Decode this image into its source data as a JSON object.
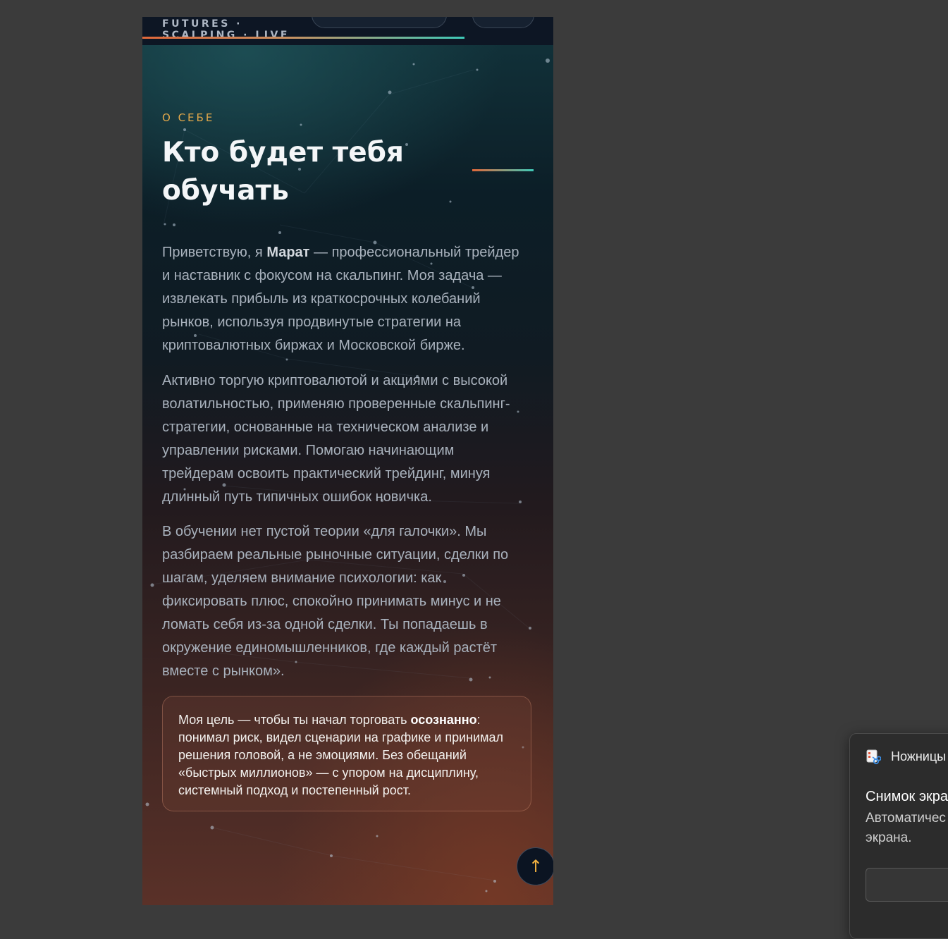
{
  "header": {
    "brand": "FUTURES ·\nSCALPING · LIVE"
  },
  "about": {
    "eyebrow": "О СЕБЕ",
    "title": "Кто будет тебя обучать",
    "p1_before": "Приветствую, я ",
    "p1_name": "Марат",
    "p1_after": " — профессиональный трейдер и наставник с фокусом на скальпинг. Моя задача — извлекать прибыль из краткосрочных колебаний рынков, используя продвинутые стратегии на криптовалютных биржах и Московской бирже.",
    "p2": "Активно торгую криптовалютой и акциями с высокой волатильностью, применяю проверенные скальпинг-стратегии, основанные на техническом анализе и управлении рисками. Помогаю начинающим трейдерам освоить практический трейдинг, минуя длинный путь типичных ошибок новичка.",
    "p3": "В обучении нет пустой теории «для галочки». Мы разбираем реальные рыночные ситуации, сделки по шагам, уделяем внимание психологии: как фиксировать плюс, спокойно принимать минус и не ломать себя из-за одной сделки. Ты попадаешь в окружение единомышленников, где каждый растёт вместе с рынком».",
    "callout_before": "Моя цель — чтобы ты начал торговать ",
    "callout_bold": "осознанно",
    "callout_after": ": понимал риск, видел сценарии на графике и принимал решения головой, а не эмоциями. Без обещаний «быстрых миллионов» — с упором на дисциплину, системный подход и постепенный рост."
  },
  "scroll_top": {
    "icon": "arrow-up-icon",
    "glyph": "↑"
  },
  "notification": {
    "app_name": "Ножницы",
    "title": "Снимок экра",
    "body": "Автоматичес\nэкрана."
  },
  "colors": {
    "accent_orange": "#e3a84a",
    "accent_gradient_start": "#e0683a",
    "accent_gradient_end": "#3ec9b8"
  }
}
